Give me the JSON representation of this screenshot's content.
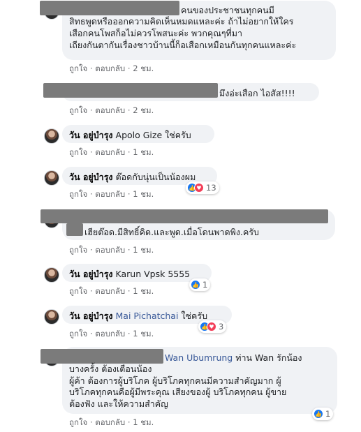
{
  "actions": {
    "like": "ถูกใจ",
    "reply": "ตอบกลับ",
    "sep": "·"
  },
  "comments": [
    {
      "lines": [
        "คนของประชาชนทุกคนมี",
        "สิทธพูดหรือออกความคิดเห็นหมดแหละค่ะ ถ้าไม่อยากให้ใคร",
        "เสือกคนโพสก็อไม่ควรโพสนะค่ะ พวกคุณๆที่มา",
        "เถียงกันตากันเรื่องชาวบ้านนี้ก็อเสือกเหมือนกันทุกคนแหละค่ะ"
      ],
      "time": "2 ชม."
    },
    {
      "lines": [
        "มึงอ่ะเสือก ไอสัส!!!!"
      ],
      "time": "2 ชม."
    },
    {
      "name": "วัน อยู่บำรุง",
      "mention": "Apolo Gize",
      "text": "ใช่ครับ",
      "time": "1 ชม."
    },
    {
      "name": "วัน อยู่บำรุง",
      "text": "ต๊อดกับนุ่นเป็นน้องผม",
      "time": "1 ชม.",
      "reactions": "13"
    },
    {
      "lines": [
        "เฮียต๊อด.มีสิทธิ์คิด.และพูด.เมื่อโดนพาดพิง.ครับ"
      ],
      "time": "1 ชม."
    },
    {
      "name": "วัน อยู่บำรุง",
      "text": "Karun Vpsk 5555",
      "time": "1 ชม.",
      "reactions": "1"
    },
    {
      "name": "วัน อยู่บำรุง",
      "mention": "Mai Pichatchai",
      "text": "ใช่ครับ",
      "time": "1 ชม.",
      "reactions": "3"
    },
    {
      "mention": "Wan Ubumrung",
      "first": "ท่าน Wan รักน้อง",
      "lines": [
        "บางครั้ง ต้องเตือนน้อง",
        "ผู้ค้า ต้องการผู้บริโภค ผู้บริโภคทุกคนมีความสำคัญมาก ผู้",
        "บริโภคทุกคนคือผู้มีพระคุณ เสียงของผู้ บริโภคทุกคน ผู้ขาย",
        "ต้องฟัง และให้ความสำคัญ"
      ],
      "time": "1 ชม.",
      "reactions": "1"
    }
  ]
}
